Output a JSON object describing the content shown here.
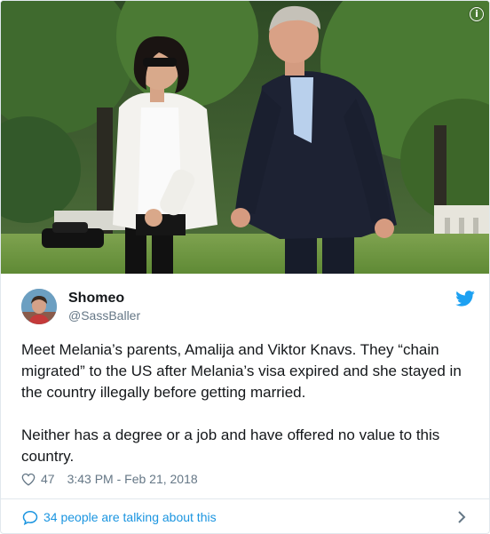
{
  "tweet": {
    "display_name": "Shomeo",
    "handle": "@SassBaller",
    "paragraphs": [
      "Meet Melania’s parents, Amalija and Viktor Knavs. They “chain migrated” to the US after Melania’s visa expired and she stayed in the country illegally before getting married.",
      "Neither has a degree or a job and have offered no value to this country."
    ],
    "like_count": "47",
    "timestamp": "3:43 PM - Feb 21, 2018",
    "talking_label": "34 people are talking about this"
  },
  "icons": {
    "info": "info-icon",
    "brand": "twitter-bird-icon",
    "like": "heart-icon",
    "conversation": "speech-bubble-icon",
    "more": "chevron-right-icon"
  },
  "colors": {
    "brand_blue": "#1da1f2",
    "link_blue": "#1b95e0",
    "text": "#14171a",
    "secondary_text": "#657786",
    "border": "#e1e8ed"
  }
}
